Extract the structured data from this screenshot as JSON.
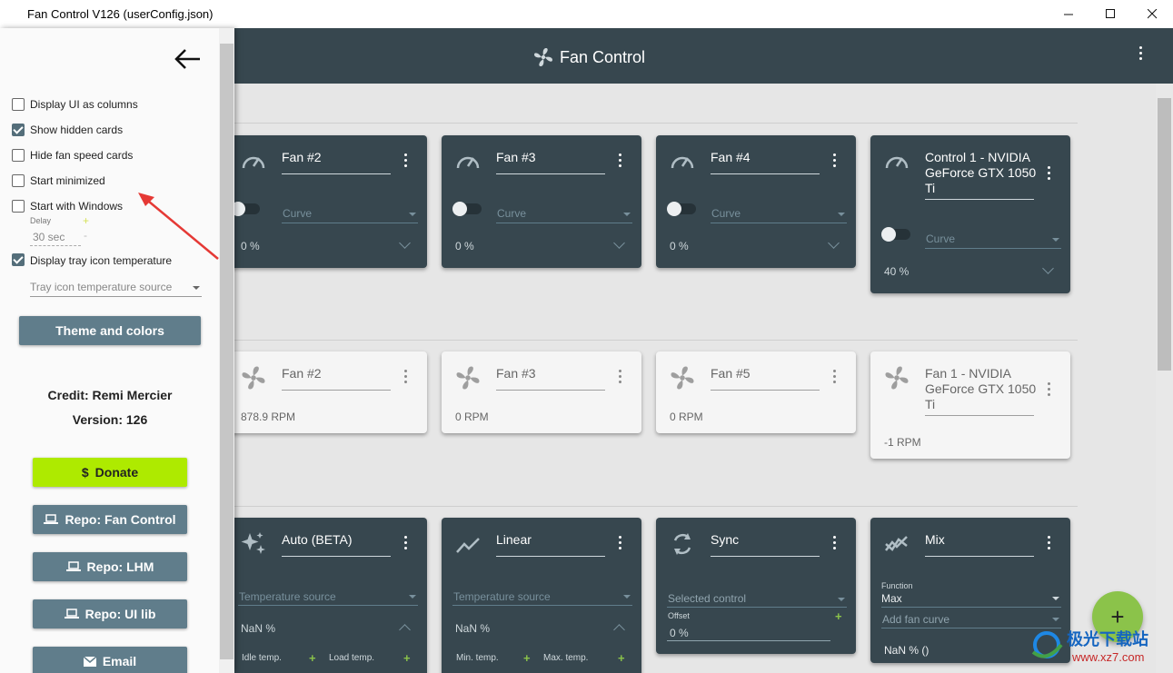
{
  "window": {
    "title": "Fan Control V126 (userConfig.json)"
  },
  "appbar": {
    "title": "Fan Control"
  },
  "settings": {
    "display_columns": "Display UI as columns",
    "show_hidden": "Show hidden cards",
    "hide_fan_speed": "Hide fan speed cards",
    "start_minimized": "Start minimized",
    "start_windows": "Start with Windows",
    "delay_label": "Delay",
    "delay_value": "30 sec",
    "display_tray": "Display tray icon temperature",
    "tray_source": "Tray icon temperature source",
    "theme_button": "Theme and colors",
    "credit": "Credit: Remi Mercier",
    "version": "Version: 126",
    "donate": "Donate",
    "donate_symbol": "$",
    "repo_fan": "Repo: Fan Control",
    "repo_lhm": "Repo: LHM",
    "repo_ui": "Repo: UI lib",
    "email": "Email",
    "checked": {
      "display_columns": false,
      "show_hidden": true,
      "hide_fan_speed": false,
      "start_minimized": false,
      "start_windows": false,
      "display_tray": true
    }
  },
  "controls": [
    {
      "name": "Fan #2",
      "mode": "Curve",
      "value": "0 %"
    },
    {
      "name": "Fan #3",
      "mode": "Curve",
      "value": "0 %"
    },
    {
      "name": "Fan #4",
      "mode": "Curve",
      "value": "0 %"
    },
    {
      "name": "Control 1 - NVIDIA GeForce GTX 1050 Ti",
      "mode": "Curve",
      "value": "40 %"
    }
  ],
  "speeds": [
    {
      "name": "Fan #2",
      "value": "878.9 RPM"
    },
    {
      "name": "Fan #3",
      "value": "0 RPM"
    },
    {
      "name": "Fan #5",
      "value": "0 RPM"
    },
    {
      "name": "Fan 1 - NVIDIA GeForce GTX 1050 Ti",
      "value": "-1 RPM"
    }
  ],
  "curves": {
    "auto": {
      "name": "Auto (BETA)",
      "source": "Temperature source",
      "value": "NaN %",
      "left": "Idle temp.",
      "right": "Load temp."
    },
    "linear": {
      "name": "Linear",
      "source": "Temperature source",
      "value": "NaN %",
      "left": "Min. temp.",
      "right": "Max. temp."
    },
    "sync": {
      "name": "Sync",
      "source": "Selected control",
      "offset_label": "Offset",
      "offset": "0 %"
    },
    "mix": {
      "name": "Mix",
      "function_label": "Function",
      "function": "Max",
      "add": "Add fan curve",
      "value": "NaN % ()"
    }
  },
  "fab": "+",
  "watermark": {
    "site": "极光下载站",
    "url": "www.xz7.com"
  },
  "colors": {
    "appbar": "#37474f",
    "accent": "#8bc34a",
    "donate": "#aeea00",
    "button": "#607d8b"
  }
}
